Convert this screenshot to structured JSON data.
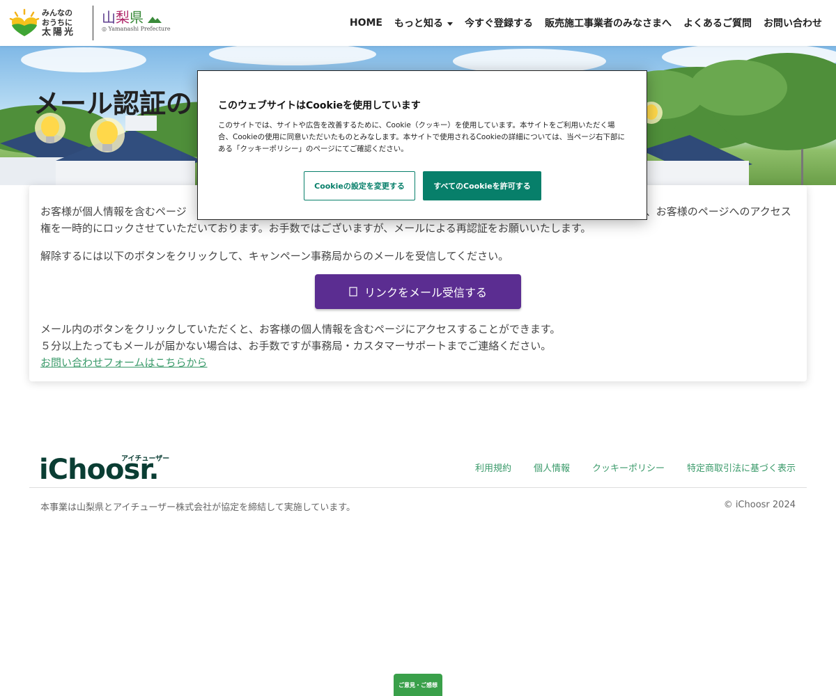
{
  "header": {
    "logo_lines": [
      "みんなの",
      "おうちに",
      "太陽光"
    ],
    "pref_name": [
      "山",
      "梨",
      "県"
    ],
    "pref_sub": "Yamanashi Prefecture",
    "nav": [
      {
        "label": "HOME"
      },
      {
        "label": "もっと知る"
      },
      {
        "label": "今すぐ登録する"
      },
      {
        "label": "販売施工事業者のみなさまへ"
      },
      {
        "label": "よくあるご質問"
      },
      {
        "label": "お問い合わせ"
      }
    ]
  },
  "hero": {
    "title": "メール認証の"
  },
  "content": {
    "p1": "お客様が個人情報を含むページ　　　　　　　　　　　　　　　　　　　　　　　　　　　　　　　　　　　　　保護規定により、お客様のページへのアクセス権を一時的にロックさせていただいております。お手数ではございますが、メールによる再認証をお願いいたします。",
    "p2": "解除するには以下のボタンをクリックして、キャンペーン事務局からのメールを受信してください。",
    "button_label": "リンクをメール受信する",
    "p3_line1": "メール内のボタンをクリックしていただくと、お客様の個人情報を含むページにアクセスすることができます。",
    "p3_line2": "５分以上たってもメールが届かない場合は、お手数ですが事務局・カスタマーサポートまでご連絡ください。",
    "contact_link": "お問い合わせフォームはこちらから"
  },
  "cookie": {
    "title": "このウェブサイトはCookieを使用しています",
    "body": "このサイトでは、サイトや広告を改善するために、Cookie（クッキー）を使用しています。本サイトをご利用いただく場合、Cookieの使用に同意いただいたものとみなします。本サイトで使用されるCookieの詳細については、当ページ右下部にある「クッキーポリシー」のページにてご確認ください。",
    "settings_label": "Cookieの設定を変更する",
    "accept_label": "すべてのCookieを許可する"
  },
  "footer": {
    "brand": "iChoosr.",
    "brand_kana": "アイチューザー",
    "links": [
      "利用規約",
      "個人情報",
      "クッキーポリシー",
      "特定商取引法に基づく表示"
    ],
    "note": "本事業は山梨県とアイチューザー株式会社が協定を締結して実施しています。",
    "copyright": "© iChoosr 2024"
  },
  "feedback_label": "ご意見・ご感想",
  "colors": {
    "accent_purple": "#5b2d91",
    "cookie_green": "#077f6a",
    "link_green": "#3a9a6a",
    "brand_dark": "#0a3d33"
  }
}
